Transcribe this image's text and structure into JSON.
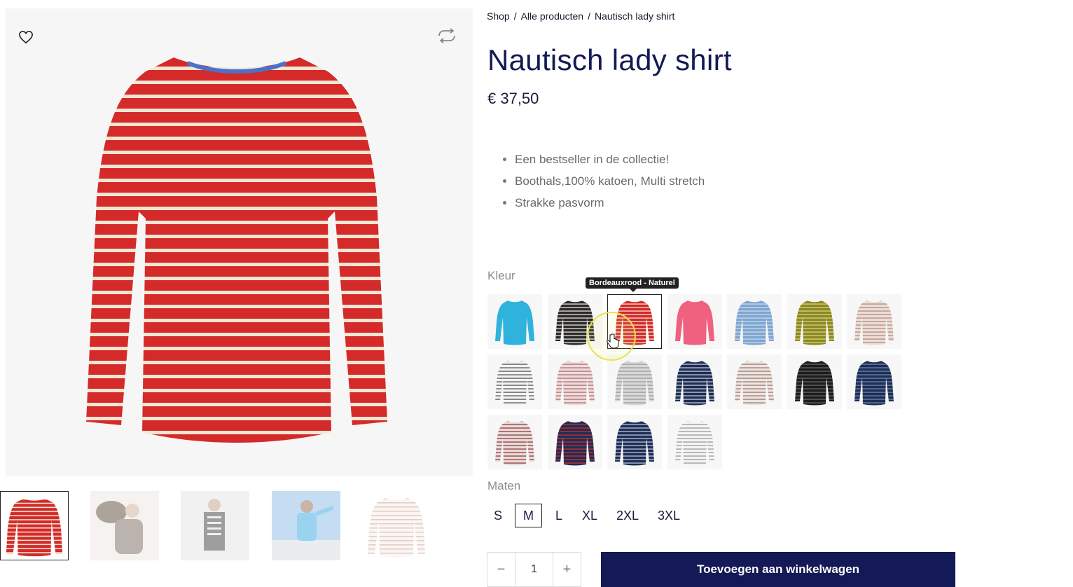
{
  "breadcrumb": {
    "items": [
      "Shop",
      "Alle producten",
      "Nautisch lady shirt"
    ],
    "separator": "/"
  },
  "product": {
    "title": "Nautisch lady shirt",
    "price": "€ 37,50",
    "features": [
      "Een bestseller in de collectie!",
      "Boothals,100% katoen, Multi stretch",
      "Strakke pasvorm"
    ]
  },
  "gallery": {
    "wishlist_icon": "heart-icon",
    "compare_icon": "compare-arrows-icon",
    "thumbnails": [
      "shirt-red-stripes",
      "lifestyle-dog",
      "lifestyle-black-stripes",
      "lifestyle-blue-shirt",
      "shirt-ecru-stripes"
    ]
  },
  "color": {
    "label": "Kleur",
    "tooltip": "Bordeauxrood - Naturel",
    "selected_index": 2,
    "swatches": [
      {
        "body": "#2fb3dd",
        "stripe": "#2fb3dd"
      },
      {
        "body": "#2b2b2b",
        "stripe": "#e8e2d6"
      },
      {
        "body": "#d42a2a",
        "stripe": "#f2e6d2"
      },
      {
        "body": "#f0607f",
        "stripe": "#f0607f"
      },
      {
        "body": "#7fa6d0",
        "stripe": "#c9daee"
      },
      {
        "body": "#8b8a1e",
        "stripe": "#d9cf8f"
      },
      {
        "body": "#e9dfd8",
        "stripe": "#b8897a"
      },
      {
        "body": "#f2f2f2",
        "stripe": "#555555"
      },
      {
        "body": "#ecdcdc",
        "stripe": "#b36a6a"
      },
      {
        "body": "#d8d8d8",
        "stripe": "#9a9a9a"
      },
      {
        "body": "#1e2e55",
        "stripe": "#c8ccd6"
      },
      {
        "body": "#ece5e0",
        "stripe": "#9b7a70"
      },
      {
        "body": "#1c1c1c",
        "stripe": "#666666"
      },
      {
        "body": "#1e2e55",
        "stripe": "#6f86ad"
      },
      {
        "body": "#e8dad8",
        "stripe": "#8c4040"
      },
      {
        "body": "#1e2e55",
        "stripe": "#d42a2a"
      },
      {
        "body": "#1e2e55",
        "stripe": "#b9c4d6"
      },
      {
        "body": "#f4f4f4",
        "stripe": "#9a9a9a"
      }
    ]
  },
  "size": {
    "label": "Maten",
    "options": [
      "S",
      "M",
      "L",
      "XL",
      "2XL",
      "3XL"
    ],
    "selected": "M"
  },
  "cart": {
    "minus": "−",
    "quantity": "1",
    "plus": "+",
    "add_label": "Toevoegen aan winkelwagen"
  },
  "colors": {
    "brand_navy": "#141a55",
    "shirt_red": "#d42a2a",
    "stripe_cream": "#f2e6d2"
  }
}
